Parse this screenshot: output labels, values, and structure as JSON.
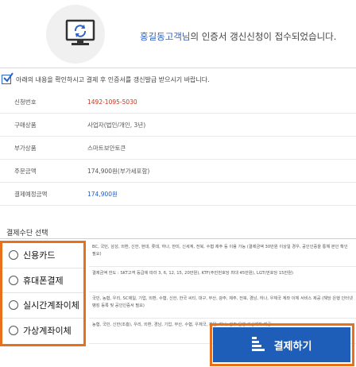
{
  "header": {
    "customer_name": "홍길동고객님",
    "message_suffix": "의 인증서 갱신신청이 접수되었습니다."
  },
  "notice": {
    "text": "아래의 내용을 확인하시고 결제 후 인증서를 갱신발급 받으시기 바랍니다."
  },
  "info_rows": [
    {
      "label": "신청번호",
      "value": "1492-1095-5030",
      "style": "red"
    },
    {
      "label": "구매상품",
      "value": "사업자(법인/개인, 3년)",
      "style": "normal"
    },
    {
      "label": "부가상품",
      "value": "스마트보안토큰",
      "style": "normal"
    },
    {
      "label": "주문금액",
      "value": "174,900원(부가세포함)",
      "style": "normal"
    },
    {
      "label": "결제예정금액",
      "value": "174,900원",
      "style": "blue"
    }
  ],
  "payment": {
    "section_title": "결제수단 선택",
    "methods": [
      {
        "label": "신용카드",
        "desc": "BC, 국민, 삼성, 외환, 신한, 현대, 롯데, 하나, 한미, 신세계, 전북, 수협 제주 등 이용 가능 (결제금액 30만원 이상일 경우, 공인인증을 통해 본인 확인 필요)"
      },
      {
        "label": "휴대폰결제",
        "desc": "결제금액 한도 : SKT고객 등급에 따라 3, 6, 12, 15, 20만원), KTF(주민번호당 최대 45만원), LGT(번호당 15만원)"
      },
      {
        "label": "실시간계좌이체",
        "desc": "국민, 농협, 우리, SC제일, 기업, 외환, 수협, 신한, 한국 씨티, 대구, 부산, 광주, 제주, 전북, 경남, 하나, 우체국 계좌 이체 서비스 제공 (해당 은행 인터넷뱅킹 등록 및 공인인증서 필요)"
      },
      {
        "label": "가상계좌이체",
        "desc": "농협, 국민, 신한(조흥), 우리, 외환, 경남, 기업, 부산, 수협, 우체국, 제일, 하나, 광주 은행 가상계좌 제공"
      }
    ],
    "submit_label": "결제하기"
  },
  "colors": {
    "accent": "#1e5db8",
    "highlight": "#e8701a",
    "name": "#2d63c8",
    "red": "#c8321e"
  },
  "icons": {
    "header": "monitor-refresh-icon",
    "notice": "checkbox-checked-icon",
    "button": "coin-stack-icon"
  }
}
